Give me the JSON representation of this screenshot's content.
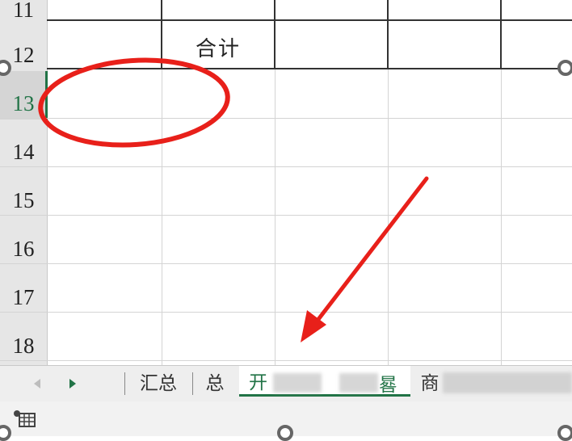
{
  "rows": [
    {
      "num": "11",
      "active": false
    },
    {
      "num": "12",
      "active": false
    },
    {
      "num": "13",
      "active": true
    },
    {
      "num": "14",
      "active": false
    },
    {
      "num": "15",
      "active": false
    },
    {
      "num": "16",
      "active": false
    },
    {
      "num": "17",
      "active": false
    },
    {
      "num": "18",
      "active": false
    }
  ],
  "cell": {
    "total_label": "合计"
  },
  "tabs": [
    {
      "label": "汇总",
      "active": false
    },
    {
      "label": "总",
      "active": false
    },
    {
      "label": "开",
      "active": true
    },
    {
      "label": "商",
      "active": false
    }
  ],
  "active_tab_partial_end": "晷",
  "icons": {
    "nav_prev": "triangle-left-icon",
    "nav_next": "triangle-right-icon",
    "status": "sheet-view-icon"
  },
  "colors": {
    "accent": "#217346",
    "annotation": "#e8201a"
  }
}
